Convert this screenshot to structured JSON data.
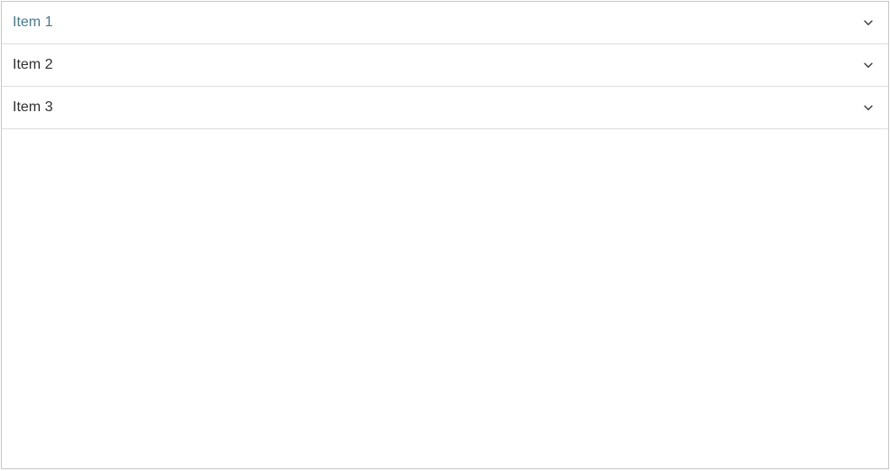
{
  "accordion": {
    "items": [
      {
        "label": "Item 1",
        "selected": true
      },
      {
        "label": "Item 2",
        "selected": false
      },
      {
        "label": "Item 3",
        "selected": false
      }
    ]
  }
}
